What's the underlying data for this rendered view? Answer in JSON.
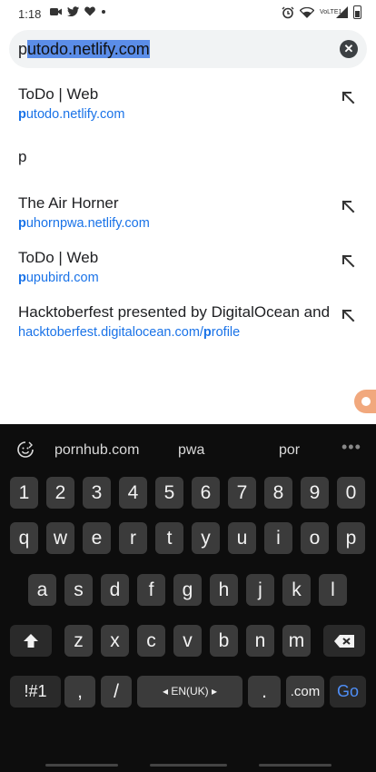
{
  "status": {
    "time": "1:18",
    "left_icons": [
      "video-icon",
      "twitter-icon",
      "heart-icon",
      "dot-icon"
    ],
    "right_icons": [
      "alarm-icon",
      "wifi-icon",
      "signal-icon",
      "battery-icon"
    ],
    "net_label": "VoLTE1"
  },
  "url_bar": {
    "prefix": "p",
    "selected": "utodo.netlify.com",
    "clear_icon": "close-icon"
  },
  "suggestions": [
    {
      "title": "ToDo | Web",
      "url_bold": "p",
      "url_rest": "utodo.netlify.com"
    },
    {
      "plain": "p"
    },
    {
      "title": "The Air Horner",
      "url_bold": "p",
      "url_rest": "uhornpwa.netlify.com"
    },
    {
      "title": "ToDo | Web",
      "url_bold": "p",
      "url_rest": "upubird.com"
    },
    {
      "title": "Hacktoberfest presented by DigitalOcean and",
      "url_prefix": "hacktoberfest.digitalocean.com/",
      "url_bold": "p",
      "url_rest": "rofile"
    }
  ],
  "keyboard": {
    "suggestions": [
      "pornhub.com",
      "pwa",
      "por"
    ],
    "more": "•••",
    "row_numbers": [
      "1",
      "2",
      "3",
      "4",
      "5",
      "6",
      "7",
      "8",
      "9",
      "0"
    ],
    "row_top": [
      "q",
      "w",
      "e",
      "r",
      "t",
      "y",
      "u",
      "i",
      "o",
      "p"
    ],
    "row_mid": [
      "a",
      "s",
      "d",
      "f",
      "g",
      "h",
      "j",
      "k",
      "l"
    ],
    "row_bottom": [
      "z",
      "x",
      "c",
      "v",
      "b",
      "n",
      "m"
    ],
    "sym": "!#1",
    "comma": ",",
    "slash": "/",
    "space": "◂ EN(UK) ▸",
    "period": ".",
    "dotcom": ".com",
    "go": "Go"
  }
}
